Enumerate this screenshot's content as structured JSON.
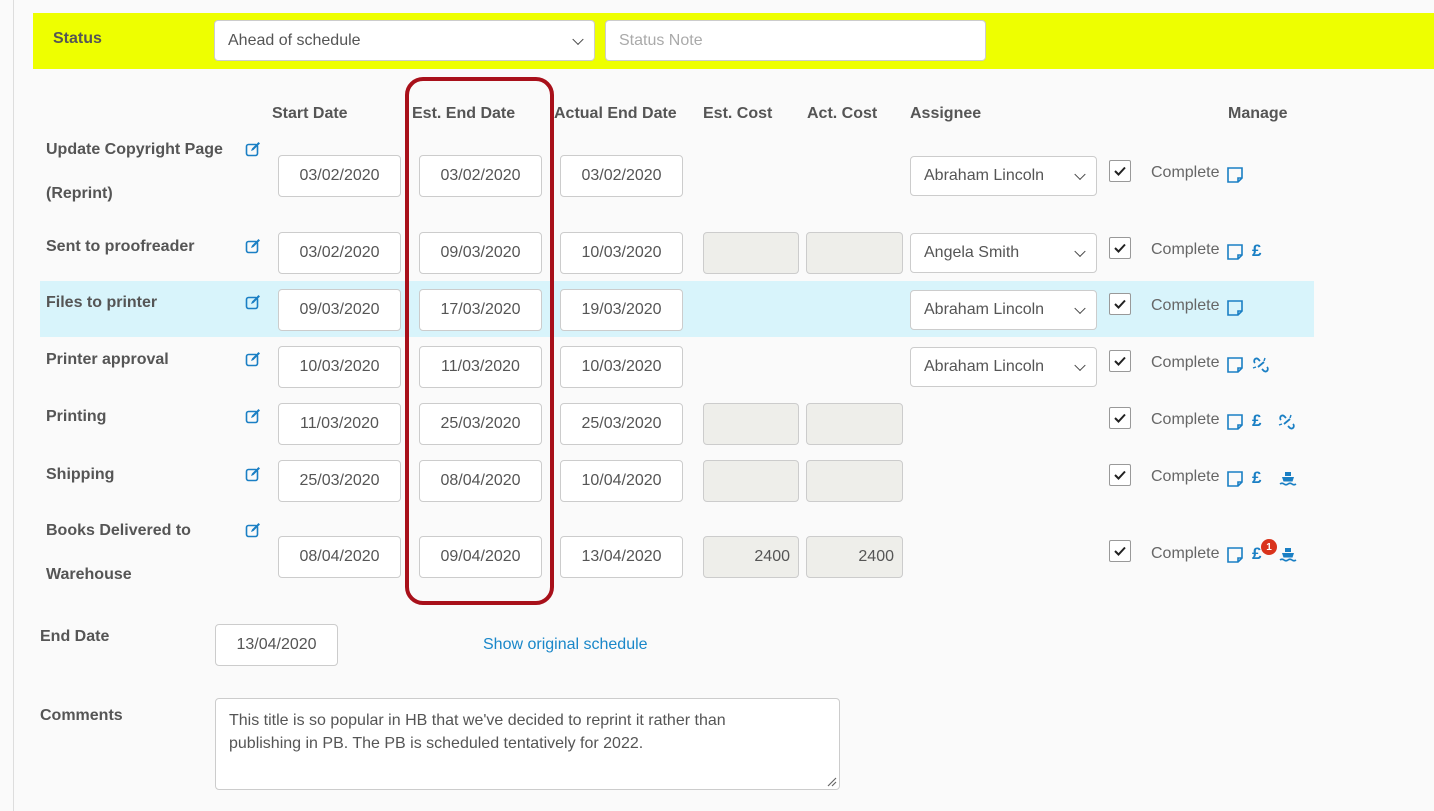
{
  "status": {
    "label": "Status",
    "selected": "Ahead of schedule",
    "note_placeholder": "Status Note"
  },
  "columns": {
    "start": "Start Date",
    "est_end": "Est. End Date",
    "actual_end": "Actual End Date",
    "est_cost": "Est. Cost",
    "act_cost": "Act. Cost",
    "assignee": "Assignee",
    "manage": "Manage"
  },
  "tasks": [
    {
      "name_line1": "Update Copyright Page",
      "name_line2": "(Reprint)",
      "start": "03/02/2020",
      "est_end": "03/02/2020",
      "actual_end": "03/02/2020",
      "assignee": "Abraham Lincoln",
      "complete": "Complete"
    },
    {
      "name": "Sent to proofreader",
      "start": "03/02/2020",
      "est_end": "09/03/2020",
      "actual_end": "10/03/2020",
      "est_cost": "",
      "act_cost": "",
      "assignee": "Angela Smith",
      "complete": "Complete"
    },
    {
      "name": "Files to printer",
      "start": "09/03/2020",
      "est_end": "17/03/2020",
      "actual_end": "19/03/2020",
      "assignee": "Abraham Lincoln",
      "complete": "Complete"
    },
    {
      "name": "Printer approval",
      "start": "10/03/2020",
      "est_end": "11/03/2020",
      "actual_end": "10/03/2020",
      "assignee": "Abraham Lincoln",
      "complete": "Complete"
    },
    {
      "name": "Printing",
      "start": "11/03/2020",
      "est_end": "25/03/2020",
      "actual_end": "25/03/2020",
      "est_cost": "",
      "act_cost": "",
      "complete": "Complete"
    },
    {
      "name": "Shipping",
      "start": "25/03/2020",
      "est_end": "08/04/2020",
      "actual_end": "10/04/2020",
      "est_cost": "",
      "act_cost": "",
      "complete": "Complete"
    },
    {
      "name_line1": "Books Delivered to",
      "name_line2": "Warehouse",
      "start": "08/04/2020",
      "est_end": "09/04/2020",
      "actual_end": "13/04/2020",
      "est_cost": "2400",
      "act_cost": "2400",
      "complete": "Complete",
      "badge": "1"
    }
  ],
  "end_date": {
    "label": "End Date",
    "value": "13/04/2020"
  },
  "show_original_link": "Show original schedule",
  "comments": {
    "label": "Comments",
    "line1": "This title is so popular in HB that we've decided to reprint it rather than",
    "line2": "publishing in PB. The PB is scheduled tentatively for 2022."
  },
  "colors": {
    "status_bar": "#eeff00",
    "highlight_row": "#d8f4fb",
    "annotation_border": "#a8101a",
    "icon_blue": "#1a7fc4",
    "badge_red": "#d9331c"
  }
}
